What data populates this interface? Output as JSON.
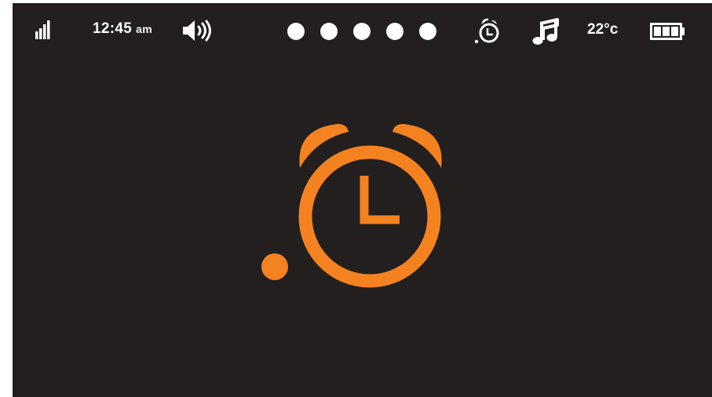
{
  "status_bar": {
    "time": "12:45",
    "time_suffix": "am",
    "temperature": "22°c",
    "signal_icon": "signal-bars-icon",
    "volume_icon": "speaker-volume-icon",
    "alarm_icon": "alarm-clock-icon",
    "music_icon": "music-note-icon",
    "battery_icon": "battery-full-icon",
    "page_indicator_count": 5
  },
  "main": {
    "icon": "alarm-clock-icon"
  },
  "colors": {
    "background": "#221f1e",
    "accent": "#f58220",
    "foreground": "#ffffff"
  }
}
